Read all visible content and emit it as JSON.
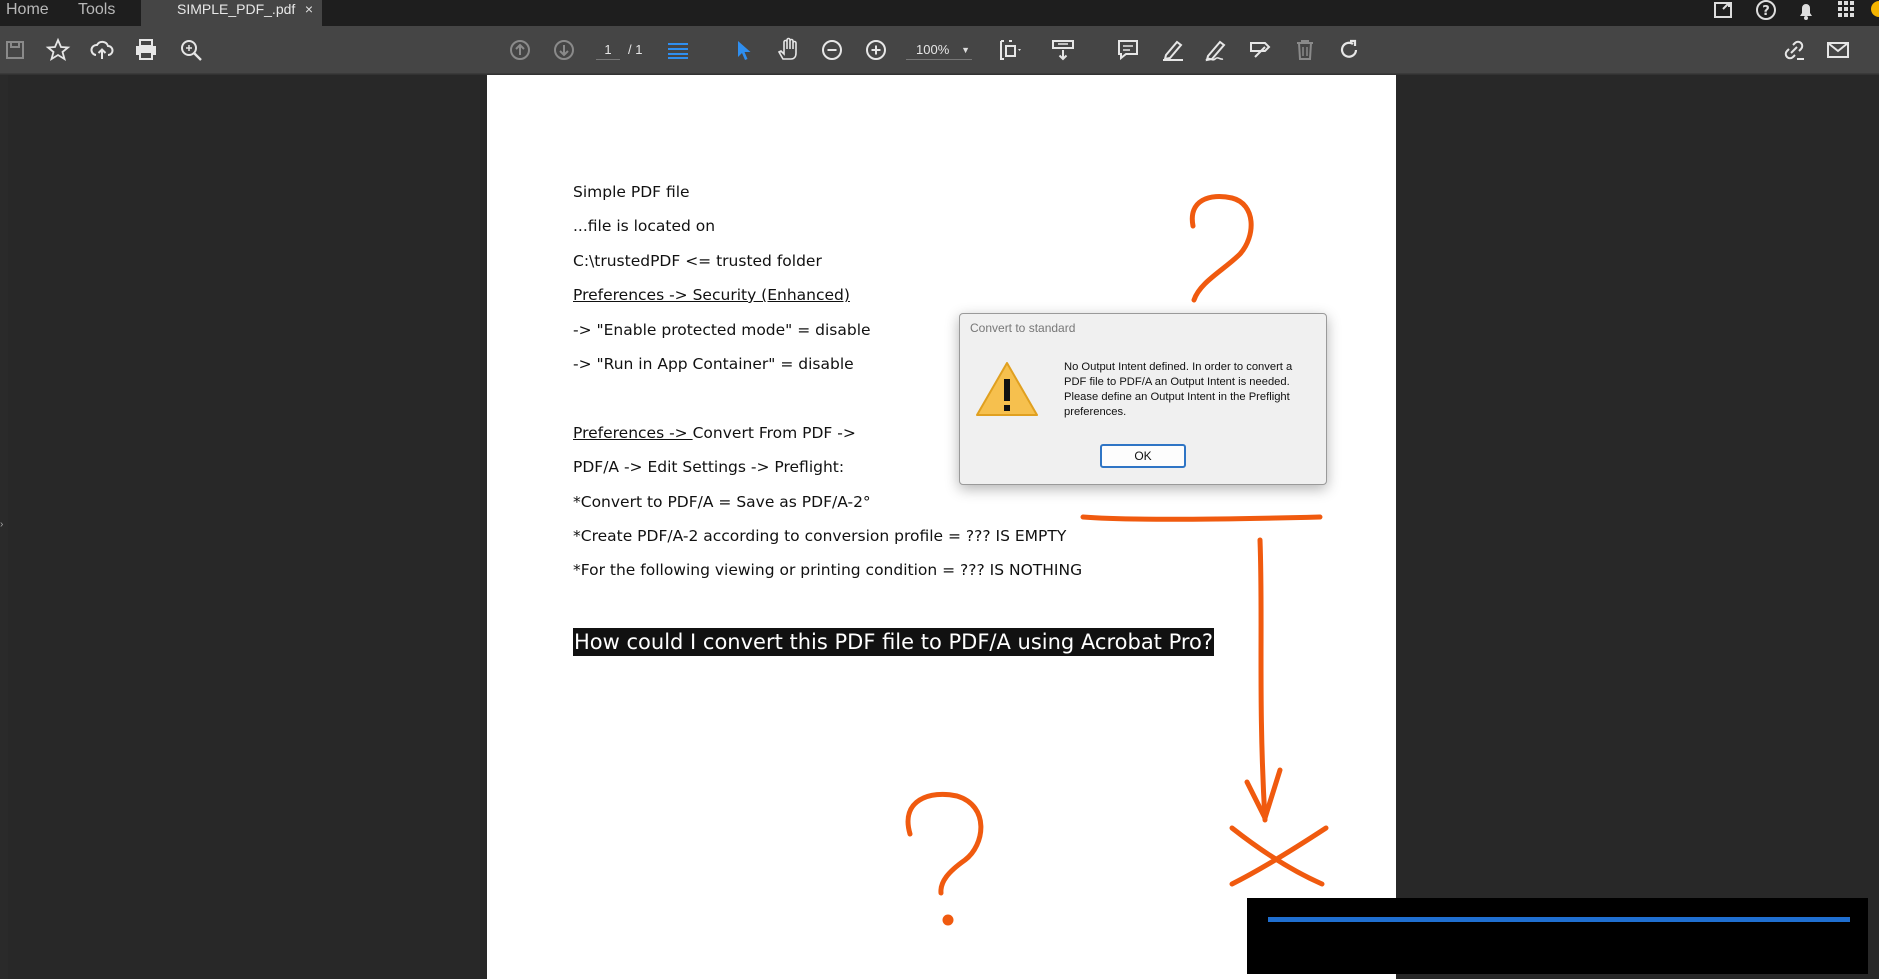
{
  "tabs": {
    "home": "Home",
    "tools": "Tools",
    "document": "SIMPLE_PDF_.pdf",
    "close": "×"
  },
  "toolbar": {
    "page_current": "1",
    "page_total": "/ 1",
    "zoom": "100%"
  },
  "document_lines": [
    "Simple PDF file",
    "...file is located on",
    "C:\\trustedPDF   <= trusted folder",
    "Preferences -> Security (Enhanced)",
    " -> \"Enable protected mode\" = disable",
    "-> \"Run in App Container\" = disable",
    "Preferences -> ",
    "Convert From PDF ->",
    "PDF/A -> Edit Settings -> Preflight:",
    "*Convert to PDF/A  = Save as PDF/A-2°",
    "*Create PDF/A-2 according to conversion profile = ??? IS EMPTY",
    "*For the following viewing or printing condition = ??? IS NOTHING"
  ],
  "question": "How could I convert this PDF file to PDF/A using Acrobat Pro?",
  "dialog": {
    "title": "Convert to standard",
    "message": "No Output Intent defined. In order to convert a PDF file to PDF/A an Output Intent is needed. Please define an Output Intent in the Preflight preferences.",
    "ok_label": "OK"
  },
  "colors": {
    "annotation": "#f05a0f",
    "accent": "#2f75c5",
    "warning": "#f5b400"
  },
  "icons": [
    "save-icon",
    "star-icon",
    "upload-icon",
    "print-icon",
    "search-icon",
    "prev-page-icon",
    "next-page-icon",
    "page-layout-icon",
    "select-cursor-icon",
    "hand-icon",
    "zoom-out-icon",
    "zoom-in-icon",
    "fit-page-icon",
    "scroll-mode-icon",
    "comment-icon",
    "highlight-icon",
    "sign-icon",
    "fill-sign-icon",
    "delete-icon",
    "redo-icon",
    "share-link-icon",
    "mail-icon",
    "help-icon",
    "bell-icon",
    "apps-grid-icon",
    "account-icon"
  ]
}
